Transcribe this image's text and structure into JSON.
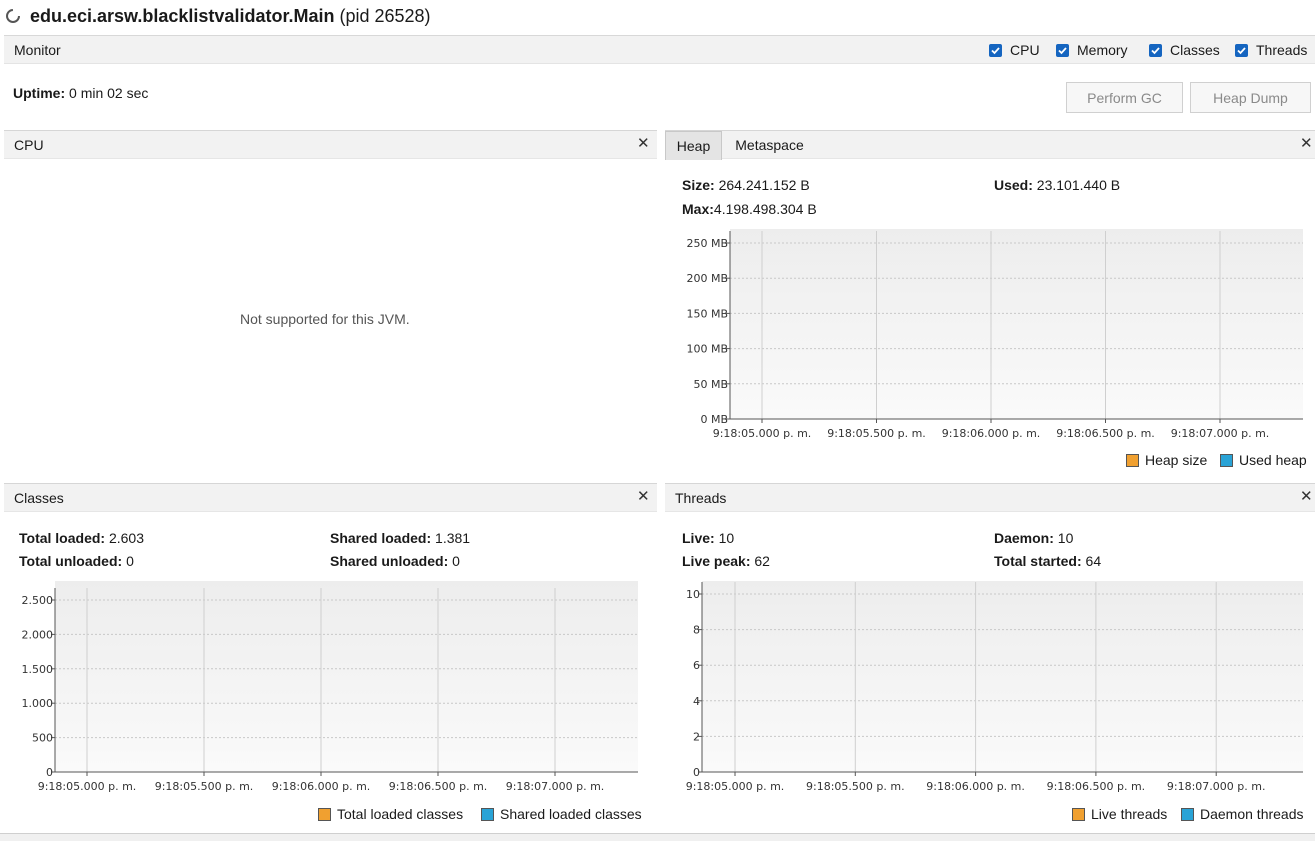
{
  "window": {
    "title_main": "edu.eci.arsw.blacklistvalidator.Main",
    "title_pid": "(pid 26528)"
  },
  "monitor": {
    "label": "Monitor",
    "checkboxes": [
      {
        "label": "CPU",
        "checked": true
      },
      {
        "label": "Memory",
        "checked": true
      },
      {
        "label": "Classes",
        "checked": true
      },
      {
        "label": "Threads",
        "checked": true
      }
    ],
    "uptime_label": "Uptime:",
    "uptime_value": "0 min 02 sec",
    "perform_gc_label": "Perform GC",
    "heap_dump_label": "Heap Dump"
  },
  "cpu_panel": {
    "title": "CPU",
    "message": "Not supported for this JVM."
  },
  "memory_panel": {
    "tabs": [
      "Heap",
      "Metaspace"
    ],
    "active_tab": "Heap",
    "size_label": "Size:",
    "size_value": "264.241.152 B",
    "used_label": "Used:",
    "used_value": "23.101.440 B",
    "max_label": "Max:",
    "max_value": "4.198.498.304 B",
    "legend": [
      "Heap size",
      "Used heap"
    ]
  },
  "classes_panel": {
    "title": "Classes",
    "total_loaded_label": "Total loaded:",
    "total_loaded_value": "2.603",
    "total_unloaded_label": "Total unloaded:",
    "total_unloaded_value": "0",
    "shared_loaded_label": "Shared loaded:",
    "shared_loaded_value": "1.381",
    "shared_unloaded_label": "Shared unloaded:",
    "shared_unloaded_value": "0",
    "legend": [
      "Total loaded classes",
      "Shared loaded classes"
    ]
  },
  "threads_panel": {
    "title": "Threads",
    "live_label": "Live:",
    "live_value": "10",
    "daemon_label": "Daemon:",
    "daemon_value": "10",
    "live_peak_label": "Live peak:",
    "live_peak_value": "62",
    "total_started_label": "Total started:",
    "total_started_value": "64",
    "legend": [
      "Live threads",
      "Daemon threads"
    ]
  },
  "colors": {
    "orange": "#f0a030",
    "blue": "#29a3d6",
    "checkbox": "#1565c0"
  },
  "chart_data": [
    {
      "type": "line",
      "name": "heap",
      "x": [
        "9:18:05.000 p. m.",
        "9:18:05.500 p. m.",
        "9:18:06.000 p. m.",
        "9:18:06.500 p. m.",
        "9:18:07.000 p. m."
      ],
      "yticks": [
        "0 MB",
        "50 MB",
        "100 MB",
        "150 MB",
        "200 MB",
        "250 MB"
      ],
      "ylim": [
        0,
        250
      ],
      "series": [],
      "legend": [
        "Heap size",
        "Used heap"
      ],
      "grid": true
    },
    {
      "type": "line",
      "name": "classes",
      "x": [
        "9:18:05.000 p. m.",
        "9:18:05.500 p. m.",
        "9:18:06.000 p. m.",
        "9:18:06.500 p. m.",
        "9:18:07.000 p. m."
      ],
      "yticks": [
        "0",
        "500",
        "1.000",
        "1.500",
        "2.000",
        "2.500"
      ],
      "ylim": [
        0,
        2500
      ],
      "series": [],
      "legend": [
        "Total loaded classes",
        "Shared loaded classes"
      ],
      "grid": true
    },
    {
      "type": "line",
      "name": "threads",
      "x": [
        "9:18:05.000 p. m.",
        "9:18:05.500 p. m.",
        "9:18:06.000 p. m.",
        "9:18:06.500 p. m.",
        "9:18:07.000 p. m."
      ],
      "yticks": [
        "0",
        "2",
        "4",
        "6",
        "8",
        "10"
      ],
      "ylim": [
        0,
        10
      ],
      "series": [],
      "legend": [
        "Live threads",
        "Daemon threads"
      ],
      "grid": true
    }
  ]
}
